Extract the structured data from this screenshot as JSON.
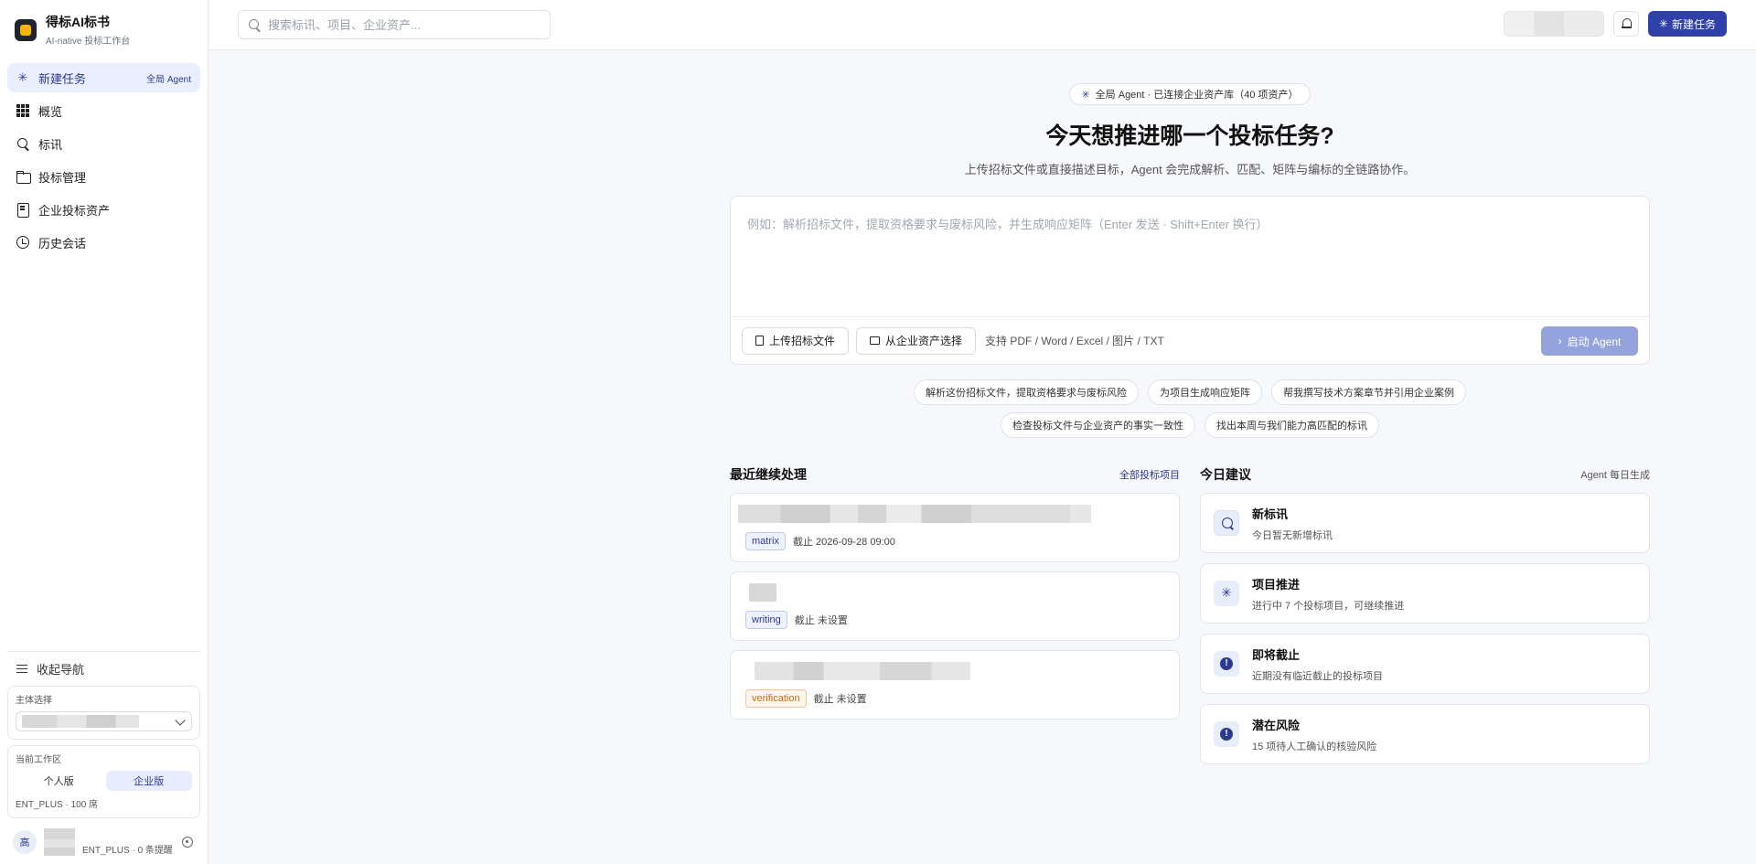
{
  "brand": {
    "title": "得标AI标书",
    "subtitle": "AI-native 投标工作台"
  },
  "sidebar": {
    "items": [
      {
        "label": "新建任务",
        "tag": "全局 Agent",
        "active": true
      },
      {
        "label": "概览"
      },
      {
        "label": "标讯"
      },
      {
        "label": "投标管理"
      },
      {
        "label": "企业投标资产"
      },
      {
        "label": "历史会话"
      }
    ],
    "collapse_label": "收起导航",
    "entity_label": "主体选择",
    "workspace_label": "当前工作区",
    "workspace_options": [
      "个人版",
      "企业版"
    ],
    "workspace_selected": "企业版",
    "plan_text": "ENT_PLUS · 100 席",
    "user": {
      "avatar_text": "高",
      "meta": "ENT_PLUS · 0 条提醒"
    }
  },
  "topbar": {
    "search_placeholder": "搜索标讯、项目、企业资产...",
    "new_task_label": "新建任务"
  },
  "hero": {
    "pill_text": "全局 Agent · 已连接企业资产库（40 项资产）",
    "title": "今天想推进哪一个投标任务?",
    "subtitle": "上传招标文件或直接描述目标，Agent 会完成解析、匹配、矩阵与编标的全链路协作。"
  },
  "composer": {
    "placeholder": "例如：解析招标文件，提取资格要求与废标风险，并生成响应矩阵（Enter 发送 · Shift+Enter 换行）",
    "upload_label": "上传招标文件",
    "asset_label": "从企业资产选择",
    "support_text": "支持 PDF / Word / Excel / 图片 / TXT",
    "start_label": "启动 Agent"
  },
  "chips": [
    "解析这份招标文件，提取资格要求与废标风险",
    "为项目生成响应矩阵",
    "帮我撰写技术方案章节并引用企业案例",
    "检查投标文件与企业资产的事实一致性",
    "找出本周与我们能力高匹配的标讯"
  ],
  "recent": {
    "title": "最近继续处理",
    "link": "全部投标项目",
    "items": [
      {
        "badge": "matrix",
        "due": "截止 2026-09-28 09:00"
      },
      {
        "badge": "writing",
        "due": "截止 未设置"
      },
      {
        "badge": "verification",
        "due": "截止 未设置"
      }
    ]
  },
  "suggestions": {
    "title": "今日建议",
    "note": "Agent 每日生成",
    "items": [
      {
        "title": "新标讯",
        "desc": "今日暂无新增标讯",
        "icon": "search-icon"
      },
      {
        "title": "项目推进",
        "desc": "进行中 7 个投标项目，可继续推进",
        "icon": "spark-icon"
      },
      {
        "title": "即将截止",
        "desc": "近期没有临近截止的投标项目",
        "icon": "alert-icon"
      },
      {
        "title": "潜在风险",
        "desc": "15 项待人工确认的核验风险",
        "icon": "alert-icon"
      }
    ]
  }
}
